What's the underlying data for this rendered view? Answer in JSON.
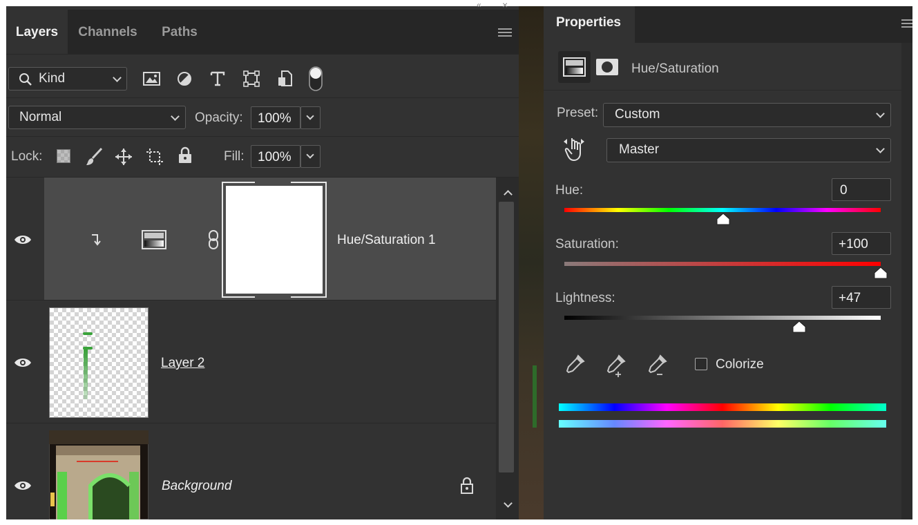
{
  "layers_panel": {
    "tabs": [
      "Layers",
      "Channels",
      "Paths"
    ],
    "filter": {
      "label": "Kind"
    },
    "blend_mode": "Normal",
    "opacity_label": "Opacity:",
    "opacity_value": "100%",
    "lock_label": "Lock:",
    "fill_label": "Fill:",
    "fill_value": "100%",
    "layers": [
      {
        "name": "Hue/Saturation 1",
        "type": "adjustment",
        "selected": true
      },
      {
        "name": "Layer 2",
        "type": "pixel",
        "selected": false
      },
      {
        "name": "Background",
        "type": "image",
        "locked": true,
        "selected": false
      }
    ]
  },
  "properties_panel": {
    "tab": "Properties",
    "adjustment_title": "Hue/Saturation",
    "preset_label": "Preset:",
    "preset_value": "Custom",
    "channel_value": "Master",
    "hue_label": "Hue:",
    "hue_value": "0",
    "hue_fraction": 0.5,
    "saturation_label": "Saturation:",
    "saturation_value": "+100",
    "saturation_fraction": 1.0,
    "lightness_label": "Lightness:",
    "lightness_value": "+47",
    "lightness_fraction": 0.735,
    "colorize_label": "Colorize",
    "colorize_checked": false
  },
  "icons": [
    "search-icon",
    "image-filter-icon",
    "adjustment-filter-icon",
    "type-filter-icon",
    "shape-filter-icon",
    "smart-object-filter-icon",
    "filter-toggle-icon",
    "lock-transparent-icon",
    "lock-paint-icon",
    "lock-move-icon",
    "lock-artboard-icon",
    "lock-all-icon",
    "eye-icon",
    "clip-arrow-icon",
    "link-icon",
    "lock-icon",
    "panel-menu-icon",
    "hand-target-icon",
    "eyedropper-icon",
    "eyedropper-plus-icon",
    "eyedropper-minus-icon"
  ]
}
